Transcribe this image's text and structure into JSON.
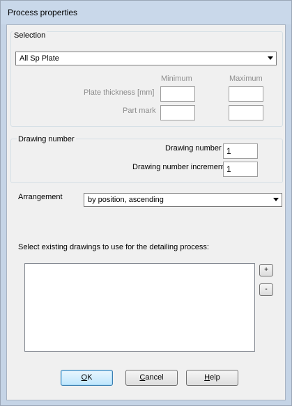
{
  "window": {
    "title": "Process properties"
  },
  "selection": {
    "group_label": "Selection",
    "filter_value": "All Sp Plate",
    "col_minimum": "Minimum",
    "col_maximum": "Maximum",
    "plate_thickness_label": "Plate thickness [mm]",
    "part_mark_label": "Part mark",
    "plate_thickness_min": "",
    "plate_thickness_max": "",
    "part_mark_min": "",
    "part_mark_max": ""
  },
  "drawing": {
    "group_label": "Drawing number",
    "number_label": "Drawing number",
    "number_value": "1",
    "increment_label": "Drawing number increment",
    "increment_value": "1"
  },
  "arrangement": {
    "label": "Arrangement",
    "value": "by position, ascending"
  },
  "existing": {
    "label": "Select existing drawings to use for the detailing process:",
    "items": [],
    "add_label": "+",
    "remove_label": "-"
  },
  "buttons": {
    "ok_mnemonic": "O",
    "ok_rest": "K",
    "cancel_mnemonic": "C",
    "cancel_rest": "ancel",
    "help_mnemonic": "H",
    "help_rest": "elp"
  }
}
